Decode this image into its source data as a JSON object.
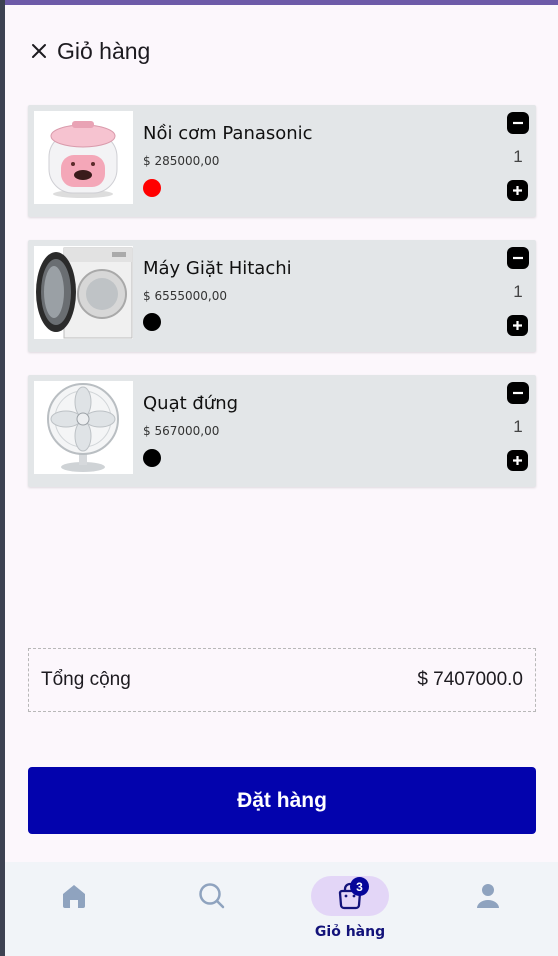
{
  "header": {
    "title": "Giỏ hàng",
    "close_icon": "close-icon"
  },
  "cart": {
    "items": [
      {
        "name": "Nồi cơm Panasonic",
        "price": "$ 285000,00",
        "quantity": "1",
        "color": "#ff0000",
        "image": "rice-cooker-image"
      },
      {
        "name": "Máy Giặt Hitachi",
        "price": "$ 6555000,00",
        "quantity": "1",
        "color": "#000000",
        "image": "washing-machine-image"
      },
      {
        "name": "Quạt đứng",
        "price": "$ 567000,00",
        "quantity": "1",
        "color": "#000000",
        "image": "standing-fan-image"
      }
    ]
  },
  "summary": {
    "total_label": "Tổng cộng",
    "total_value": "$ 7407000.0"
  },
  "actions": {
    "order_label": "Đặt hàng"
  },
  "nav": {
    "items": [
      {
        "icon": "home-icon",
        "label": ""
      },
      {
        "icon": "search-icon",
        "label": ""
      },
      {
        "icon": "shopping-bag-icon",
        "label": "Giỏ hàng",
        "badge": "3",
        "active": true
      },
      {
        "icon": "person-icon",
        "label": ""
      }
    ]
  },
  "colors": {
    "accent": "#0303ad",
    "nav_active_bg": "#e3d6f7",
    "item_bg": "#e3e6e8",
    "status_bar": "#6d5aa8"
  }
}
